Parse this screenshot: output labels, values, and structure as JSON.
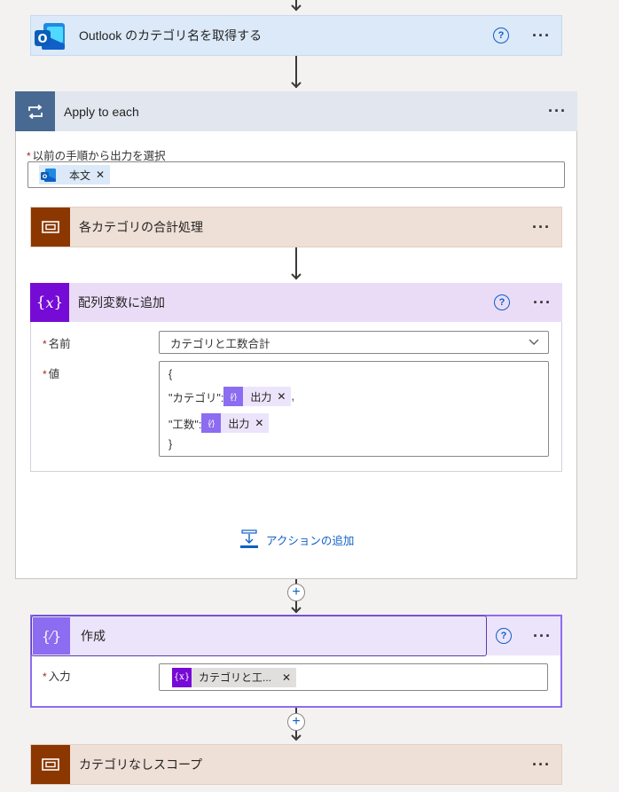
{
  "steps": {
    "outlook": {
      "title": "Outlook のカテゴリ名を取得する",
      "help": "?",
      "more": "···"
    },
    "apply": {
      "title": "Apply to each",
      "more": "···",
      "field_label": "以前の手順から出力を選択",
      "token": "本文"
    },
    "scope1": {
      "title": "各カテゴリの合計処理",
      "more": "···"
    },
    "append": {
      "title": "配列変数に追加",
      "help": "?",
      "more": "···",
      "name_label": "名前",
      "name_value": "カテゴリと工数合計",
      "value_label": "値",
      "lines": {
        "open": "{",
        "cat_key": "\"カテゴリ\":",
        "cat_token": "出力",
        "comma": ",",
        "hours_key": "\"工数\":",
        "hours_token": "出力",
        "close": "}"
      }
    },
    "add_action": "アクションの追加",
    "compose": {
      "title": "作成",
      "help": "?",
      "more": "···",
      "input_label": "入力",
      "token": "カテゴリと工..."
    },
    "scope2": {
      "title": "カテゴリなしスコープ",
      "more": "···"
    }
  },
  "colors": {
    "outlook_header": "#dbe9f8",
    "apply_header": "#e1e6ef",
    "apply_icon": "#486991",
    "scope_header": "#eedfd7",
    "scope_icon": "#8c3700",
    "variable_header": "#eadcf7",
    "variable_icon": "#770bd6",
    "compose_header": "#ece4fb",
    "compose_icon": "#8c6cf0"
  }
}
